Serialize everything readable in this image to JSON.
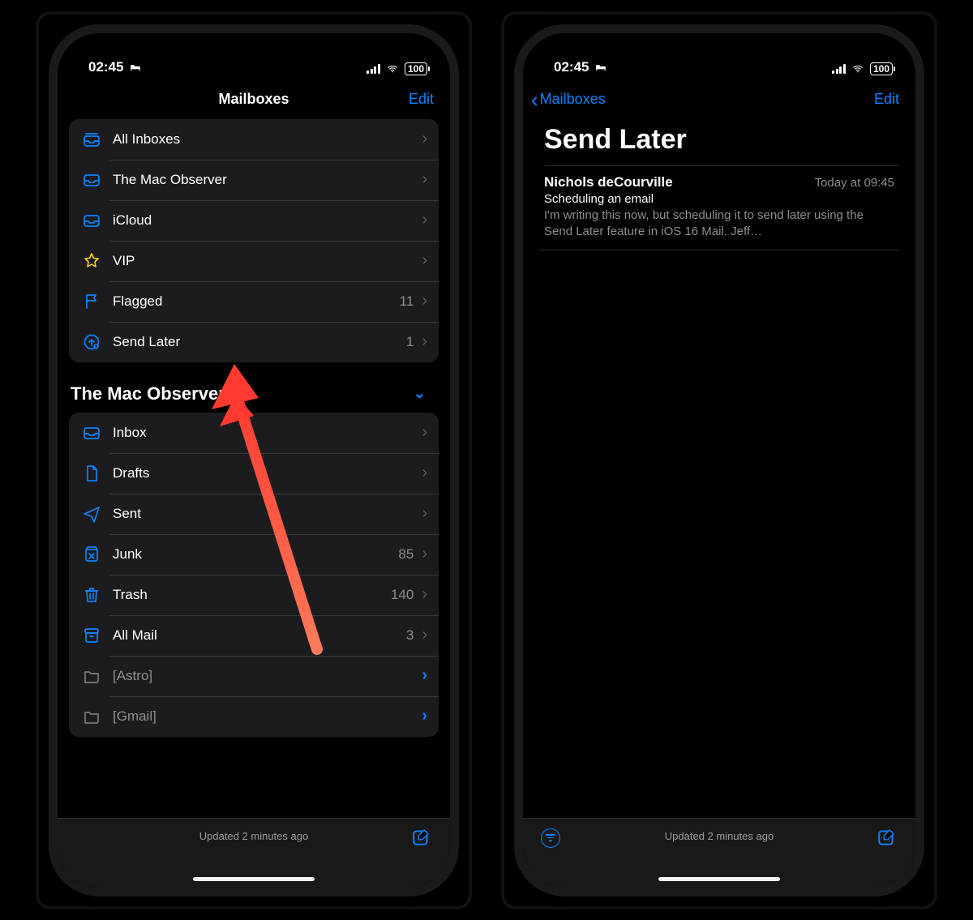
{
  "status": {
    "time": "02:45",
    "battery": "100"
  },
  "left": {
    "nav": {
      "title": "Mailboxes",
      "edit": "Edit"
    },
    "mailboxes": [
      {
        "icon": "all-inboxes",
        "label": "All Inboxes",
        "count": ""
      },
      {
        "icon": "inbox",
        "label": "The Mac Observer",
        "count": ""
      },
      {
        "icon": "inbox",
        "label": "iCloud",
        "count": ""
      },
      {
        "icon": "star",
        "label": "VIP",
        "count": ""
      },
      {
        "icon": "flag",
        "label": "Flagged",
        "count": "11"
      },
      {
        "icon": "send-later",
        "label": "Send Later",
        "count": "1"
      }
    ],
    "account_header": "The Mac Observer",
    "account_items": [
      {
        "icon": "inbox",
        "label": "Inbox",
        "count": "",
        "dim": false
      },
      {
        "icon": "doc",
        "label": "Drafts",
        "count": "",
        "dim": false
      },
      {
        "icon": "paperplane",
        "label": "Sent",
        "count": "",
        "dim": false
      },
      {
        "icon": "junk",
        "label": "Junk",
        "count": "85",
        "dim": false
      },
      {
        "icon": "trash",
        "label": "Trash",
        "count": "140",
        "dim": false
      },
      {
        "icon": "archive",
        "label": "All Mail",
        "count": "3",
        "dim": false
      },
      {
        "icon": "folder",
        "label": "[Astro]",
        "count": "",
        "dim": true,
        "blue_chev": true
      },
      {
        "icon": "folder",
        "label": "[Gmail]",
        "count": "",
        "dim": true,
        "blue_chev": true
      }
    ],
    "toolbar_status": "Updated 2 minutes ago"
  },
  "right": {
    "nav": {
      "back": "Mailboxes",
      "edit": "Edit"
    },
    "title": "Send Later",
    "message": {
      "from": "Nichols deCourville",
      "date": "Today at 09:45",
      "subject": "Scheduling an email",
      "preview": "I'm writing this now, but scheduling it to send later using the Send Later feature in iOS 16 Mail. Jeff…"
    },
    "toolbar_status": "Updated 2 minutes ago"
  }
}
